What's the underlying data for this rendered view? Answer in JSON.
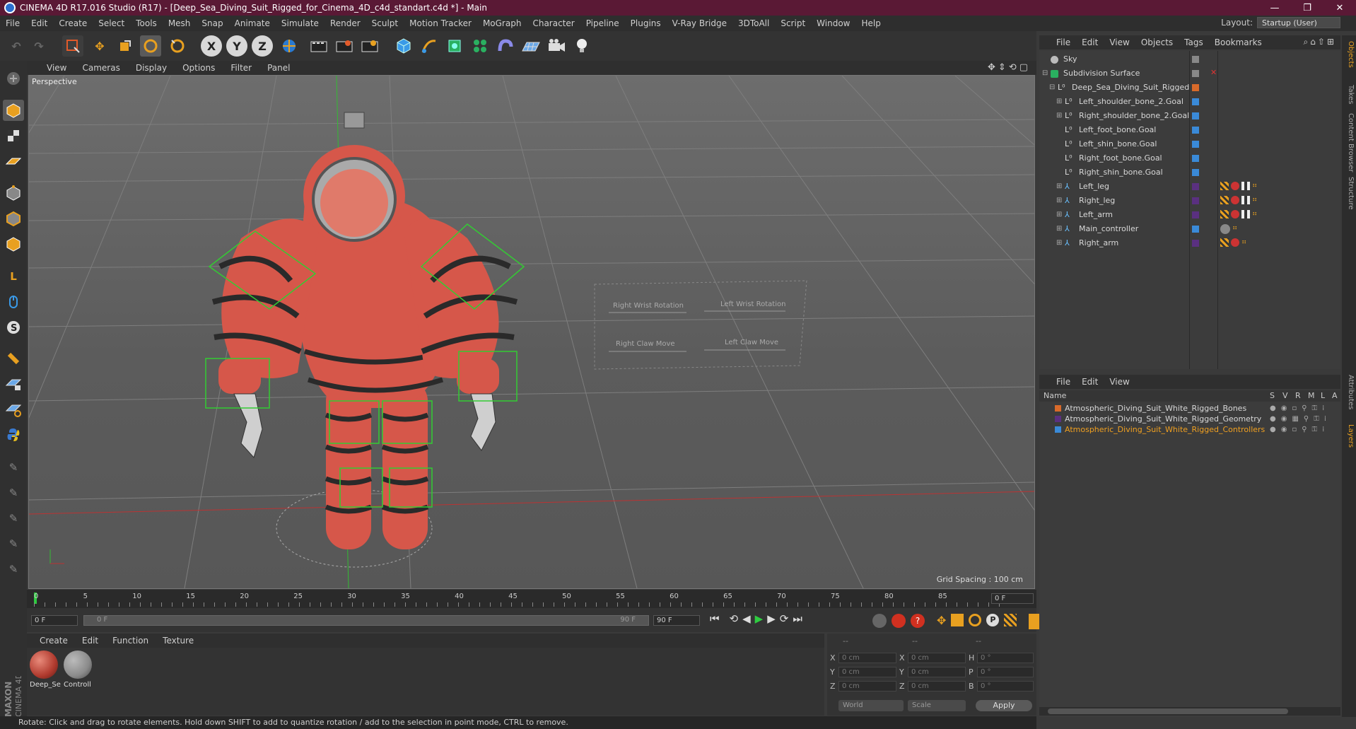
{
  "window": {
    "title": "CINEMA 4D R17.016 Studio (R17) - [Deep_Sea_Diving_Suit_Rigged_for_Cinema_4D_c4d_standart.c4d *] - Main",
    "minimize": "—",
    "maximize": "❐",
    "close": "✕"
  },
  "menubar": {
    "items": [
      "File",
      "Edit",
      "Create",
      "Select",
      "Tools",
      "Mesh",
      "Snap",
      "Animate",
      "Simulate",
      "Render",
      "Sculpt",
      "Motion Tracker",
      "MoGraph",
      "Character",
      "Pipeline",
      "Plugins",
      "V-Ray Bridge",
      "3DToAll",
      "Script",
      "Window",
      "Help"
    ],
    "layout_label": "Layout:",
    "layout_value": "Startup (User)"
  },
  "toolbar": {
    "axis_x": "X",
    "axis_y": "Y",
    "axis_z": "Z"
  },
  "viewport": {
    "menu": [
      "View",
      "Cameras",
      "Display",
      "Options",
      "Filter",
      "Panel"
    ],
    "label": "Perspective",
    "grid_spacing": "Grid Spacing : 100 cm",
    "hud": {
      "right_wrist_rotation": "Right Wrist Rotation",
      "left_wrist_rotation": "Left Wrist Rotation",
      "right_claw_move": "Right Claw Move",
      "left_claw_move": "Left Claw Move"
    }
  },
  "timeline": {
    "ticks": [
      "0",
      "5",
      "10",
      "15",
      "20",
      "25",
      "30",
      "35",
      "40",
      "45",
      "50",
      "55",
      "60",
      "65",
      "70",
      "75",
      "80",
      "85",
      "90"
    ],
    "current_frame": "0 F",
    "start_frame": "0 F",
    "range_start": "0 F",
    "range_end": "90 F",
    "end_frame": "90 F"
  },
  "materials": {
    "menu": [
      "Create",
      "Edit",
      "Function",
      "Texture"
    ],
    "items": [
      {
        "label": "Deep_Se",
        "color": "#b03a2e"
      },
      {
        "label": "Controll",
        "color": "#8a8a8a"
      }
    ]
  },
  "coordinates": {
    "header_left": "--",
    "header_mid": "--",
    "header_right": "--",
    "rows": [
      {
        "a": "X",
        "av": "0 cm",
        "b": "X",
        "bv": "0 cm",
        "c": "H",
        "cv": "0 °"
      },
      {
        "a": "Y",
        "av": "0 cm",
        "b": "Y",
        "bv": "0 cm",
        "c": "P",
        "cv": "0 °"
      },
      {
        "a": "Z",
        "av": "0 cm",
        "b": "Z",
        "bv": "0 cm",
        "c": "B",
        "cv": "0 °"
      }
    ],
    "mode": "World",
    "scale": "Scale",
    "apply": "Apply"
  },
  "status": "Rotate: Click and drag to rotate elements. Hold down SHIFT to add to quantize rotation / add to the selection in point mode, CTRL to remove.",
  "object_manager": {
    "menu": [
      "File",
      "Edit",
      "View",
      "Objects",
      "Tags",
      "Bookmarks"
    ],
    "objects": [
      {
        "name": "Sky",
        "indent": 0,
        "color": "#9a9a9a"
      },
      {
        "name": "Subdivision Surface",
        "indent": 0,
        "color": "#9a9a9a"
      },
      {
        "name": "Deep_Sea_Diving_Suit_Rigged",
        "indent": 1,
        "color": "#d86a2a"
      },
      {
        "name": "Left_shoulder_bone_2.Goal",
        "indent": 2,
        "color": "#3a8ad8"
      },
      {
        "name": "Right_shoulder_bone_2.Goal",
        "indent": 2,
        "color": "#3a8ad8"
      },
      {
        "name": "Left_foot_bone.Goal",
        "indent": 2,
        "color": "#3a8ad8"
      },
      {
        "name": "Left_shin_bone.Goal",
        "indent": 2,
        "color": "#3a8ad8"
      },
      {
        "name": "Right_foot_bone.Goal",
        "indent": 2,
        "color": "#3a8ad8"
      },
      {
        "name": "Right_shin_bone.Goal",
        "indent": 2,
        "color": "#3a8ad8"
      },
      {
        "name": "Left_leg",
        "indent": 2,
        "color": "#5a3080"
      },
      {
        "name": "Right_leg",
        "indent": 2,
        "color": "#5a3080"
      },
      {
        "name": "Left_arm",
        "indent": 2,
        "color": "#5a3080"
      },
      {
        "name": "Main_controller",
        "indent": 2,
        "color": "#3a8ad8"
      },
      {
        "name": "Right_arm",
        "indent": 2,
        "color": "#5a3080"
      }
    ]
  },
  "layer_manager": {
    "menu": [
      "File",
      "Edit",
      "View"
    ],
    "columns": {
      "name": "Name",
      "s": "S",
      "v": "V",
      "r": "R",
      "m": "M",
      "l": "L",
      "a": "A"
    },
    "layers": [
      {
        "name": "Atmospheric_Diving_Suit_White_Rigged_Bones",
        "color": "#d86a2a",
        "text_color": "#d8d8d8"
      },
      {
        "name": "Atmospheric_Diving_Suit_White_Rigged_Geometry",
        "color": "#5a3080",
        "text_color": "#d8d8d8"
      },
      {
        "name": "Atmospheric_Diving_Suit_White_Rigged_Controllers",
        "color": "#3a8ad8",
        "text_color": "#f0a020"
      }
    ]
  },
  "right_tabs": [
    "Objects",
    "Takes",
    "Content Browser",
    "Structure",
    "Attributes",
    "Layers"
  ],
  "brand": "MAXON CINEMA 4D"
}
